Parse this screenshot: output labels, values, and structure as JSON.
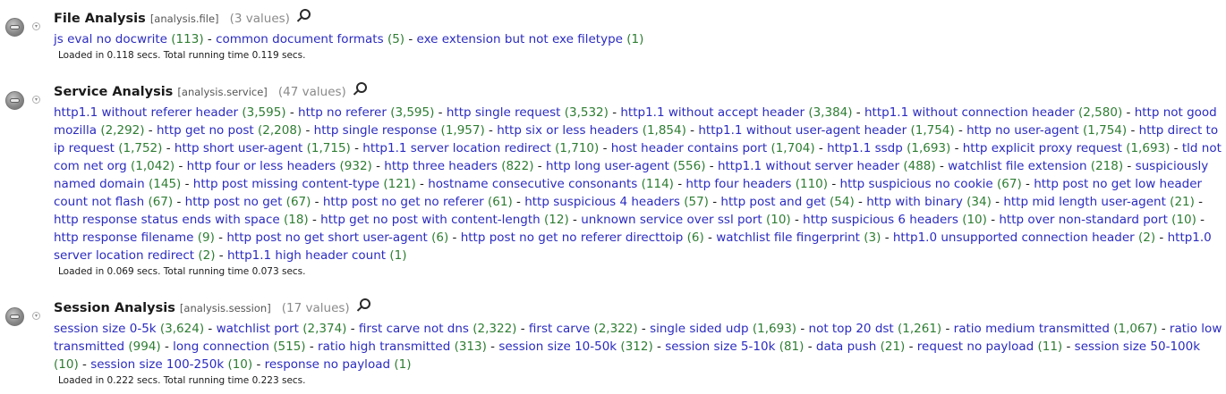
{
  "sections": [
    {
      "title": "File Analysis",
      "field": "[analysis.file]",
      "count": "(3 values)",
      "items": [
        {
          "label": "js eval no docwrite",
          "count": "(113)"
        },
        {
          "label": "common document formats",
          "count": "(5)"
        },
        {
          "label": "exe extension but not exe filetype",
          "count": "(1)"
        }
      ],
      "loaded": "Loaded in 0.118 secs. Total running time 0.119 secs."
    },
    {
      "title": "Service Analysis",
      "field": "[analysis.service]",
      "count": "(47 values)",
      "items": [
        {
          "label": "http1.1 without referer header",
          "count": "(3,595)"
        },
        {
          "label": "http no referer",
          "count": "(3,595)"
        },
        {
          "label": "http single request",
          "count": "(3,532)"
        },
        {
          "label": "http1.1 without accept header",
          "count": "(3,384)"
        },
        {
          "label": "http1.1 without connection header",
          "count": "(2,580)"
        },
        {
          "label": "http not good mozilla",
          "count": "(2,292)"
        },
        {
          "label": "http get no post",
          "count": "(2,208)"
        },
        {
          "label": "http single response",
          "count": "(1,957)"
        },
        {
          "label": "http six or less headers",
          "count": "(1,854)"
        },
        {
          "label": "http1.1 without user-agent header",
          "count": "(1,754)"
        },
        {
          "label": "http no user-agent",
          "count": "(1,754)"
        },
        {
          "label": "http direct to ip request",
          "count": "(1,752)"
        },
        {
          "label": "http short user-agent",
          "count": "(1,715)"
        },
        {
          "label": "http1.1 server location redirect",
          "count": "(1,710)"
        },
        {
          "label": "host header contains port",
          "count": "(1,704)"
        },
        {
          "label": "http1.1 ssdp",
          "count": "(1,693)"
        },
        {
          "label": "http explicit proxy request",
          "count": "(1,693)"
        },
        {
          "label": "tld not com net org",
          "count": "(1,042)"
        },
        {
          "label": "http four or less headers",
          "count": "(932)"
        },
        {
          "label": "http three headers",
          "count": "(822)"
        },
        {
          "label": "http long user-agent",
          "count": "(556)"
        },
        {
          "label": "http1.1 without server header",
          "count": "(488)"
        },
        {
          "label": "watchlist file extension",
          "count": "(218)"
        },
        {
          "label": "suspiciously named domain",
          "count": "(145)"
        },
        {
          "label": "http post missing content-type",
          "count": "(121)"
        },
        {
          "label": "hostname consecutive consonants",
          "count": "(114)"
        },
        {
          "label": "http four headers",
          "count": "(110)"
        },
        {
          "label": "http suspicious no cookie",
          "count": "(67)"
        },
        {
          "label": "http post no get low header count not flash",
          "count": "(67)"
        },
        {
          "label": "http post no get",
          "count": "(67)"
        },
        {
          "label": "http post no get no referer",
          "count": "(61)"
        },
        {
          "label": "http suspicious 4 headers",
          "count": "(57)"
        },
        {
          "label": "http post and get",
          "count": "(54)"
        },
        {
          "label": "http with binary",
          "count": "(34)"
        },
        {
          "label": "http mid length user-agent",
          "count": "(21)"
        },
        {
          "label": "http response status ends with space",
          "count": "(18)"
        },
        {
          "label": "http get no post with content-length",
          "count": "(12)"
        },
        {
          "label": "unknown service over ssl port",
          "count": "(10)"
        },
        {
          "label": "http suspicious 6 headers",
          "count": "(10)"
        },
        {
          "label": "http over non-standard port",
          "count": "(10)"
        },
        {
          "label": "http response filename",
          "count": "(9)"
        },
        {
          "label": "http post no get short user-agent",
          "count": "(6)"
        },
        {
          "label": "http post no get no referer directtoip",
          "count": "(6)"
        },
        {
          "label": "watchlist file fingerprint",
          "count": "(3)"
        },
        {
          "label": "http1.0 unsupported connection header",
          "count": "(2)"
        },
        {
          "label": "http1.0 server location redirect",
          "count": "(2)"
        },
        {
          "label": "http1.1 high header count",
          "count": "(1)"
        }
      ],
      "loaded": "Loaded in 0.069 secs. Total running time 0.073 secs."
    },
    {
      "title": "Session Analysis",
      "field": "[analysis.session]",
      "count": "(17 values)",
      "items": [
        {
          "label": "session size 0-5k",
          "count": "(3,624)"
        },
        {
          "label": "watchlist port",
          "count": "(2,374)"
        },
        {
          "label": "first carve not dns",
          "count": "(2,322)"
        },
        {
          "label": "first carve",
          "count": "(2,322)"
        },
        {
          "label": "single sided udp",
          "count": "(1,693)"
        },
        {
          "label": "not top 20 dst",
          "count": "(1,261)"
        },
        {
          "label": "ratio medium transmitted",
          "count": "(1,067)"
        },
        {
          "label": "ratio low transmitted",
          "count": "(994)"
        },
        {
          "label": "long connection",
          "count": "(515)"
        },
        {
          "label": "ratio high transmitted",
          "count": "(313)"
        },
        {
          "label": "session size 10-50k",
          "count": "(312)"
        },
        {
          "label": "session size 5-10k",
          "count": "(81)"
        },
        {
          "label": "data push",
          "count": "(21)"
        },
        {
          "label": "request no payload",
          "count": "(11)"
        },
        {
          "label": "session size 50-100k",
          "count": "(10)"
        },
        {
          "label": "session size 100-250k",
          "count": "(10)"
        },
        {
          "label": "response no payload",
          "count": "(1)"
        }
      ],
      "loaded": "Loaded in 0.222 secs. Total running time 0.223 secs."
    }
  ],
  "icons": {
    "section_toggle": "session-circle-icon",
    "collapse": "chevron-down-icon",
    "search": "search-icon"
  },
  "colors": {
    "link": "#2b2bc0",
    "count": "#2e7d32"
  }
}
